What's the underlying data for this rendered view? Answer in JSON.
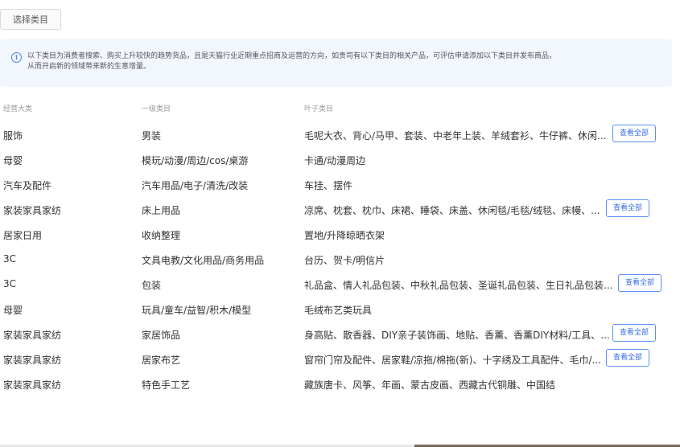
{
  "select_button": "选择类目",
  "notice": {
    "line1": "以下类目为消费者搜索、购买上升较快的趋势货品，且是天猫行业近期重点招商及运营的方向，如贵司有以下类目的相关产品，可评估申请添加以下类目并发布商品，",
    "line2": "从而开启新的领域带来新的生意增量。"
  },
  "headers": {
    "c1": "经营大类",
    "c2": "一级类目",
    "c3": "叶子类目"
  },
  "rows": [
    {
      "c1": "服饰",
      "c2": "男装",
      "c3": "毛呢大衣、背心/马甲、套装、中老年上装、羊绒套衫、牛仔裤、休闲...",
      "button": "查看全部"
    },
    {
      "c1": "母婴",
      "c2": "模玩/动漫/周边/cos/桌游",
      "c3": "卡通/动漫周边"
    },
    {
      "c1": "汽车及配件",
      "c2": "汽车用品/电子/清洗/改装",
      "c3": "车挂、摆件"
    },
    {
      "c1": "家装家具家纺",
      "c2": "床上用品",
      "c3": "凉席、枕套、枕巾、床裙、睡袋、床盖、休闲毯/毛毯/绒毯、床幔、...",
      "button": "查看全部"
    },
    {
      "c1": "居家日用",
      "c2": "收纳整理",
      "c3": "置地/升降晾晒衣架"
    },
    {
      "c1": "3C",
      "c2": "文具电教/文化用品/商务用品",
      "c3": "台历、贺卡/明信片"
    },
    {
      "c1": "3C",
      "c2": "包装",
      "c3": "礼品盒、情人礼品包装、中秋礼品包装、圣诞礼品包装、生日礼品包装...",
      "button": "查看全部"
    },
    {
      "c1": "母婴",
      "c2": "玩具/童车/益智/积木/模型",
      "c3": "毛绒布艺类玩具"
    },
    {
      "c1": "家装家具家纺",
      "c2": "家居饰品",
      "c3": "身高贴、散香器、DIY亲子装饰画、地贴、香薰、香薰DIY材料/工具、...",
      "button": "查看全部"
    },
    {
      "c1": "家装家具家纺",
      "c2": "居家布艺",
      "c3": "窗帘门帘及配件、居家鞋/凉拖/棉拖(新)、十字绣及工具配件、毛巾/...",
      "button": "查看全部"
    },
    {
      "c1": "家装家具家纺",
      "c2": "特色手工艺",
      "c3": "藏族唐卡、风筝、年画、蒙古皮画、西藏古代铜雕、中国结"
    }
  ]
}
